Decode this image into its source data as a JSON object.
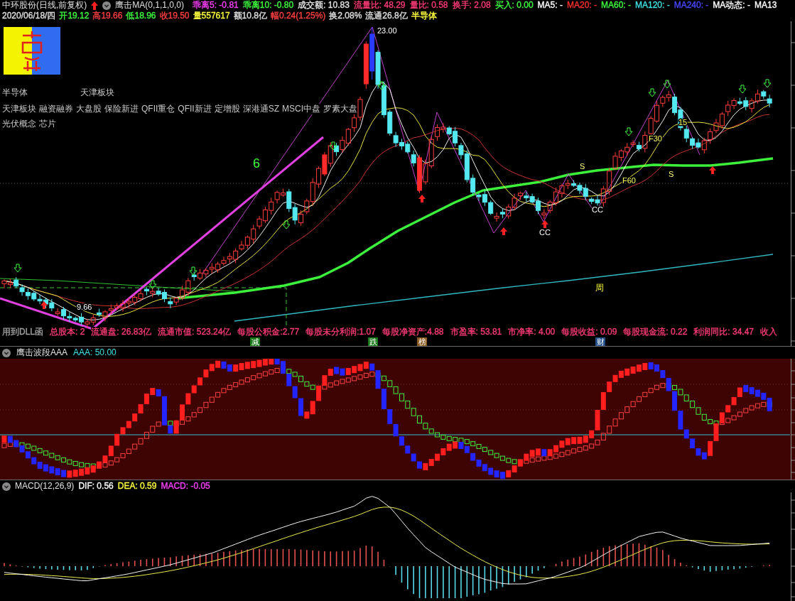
{
  "header": {
    "title": "中环股份(日线,前复权)",
    "formula": "鹰击MA(0,1,1,0,0)",
    "readouts": [
      {
        "text": "乖离5: -0.81",
        "color": "#ff40ff"
      },
      {
        "text": "乖离10: -0.80",
        "color": "#40ff40"
      },
      {
        "text": "成交额: 10.83",
        "color": "#e0e0e0"
      },
      {
        "text": "流量比: 48.29",
        "color": "#ff3c78"
      },
      {
        "text": "量比: 0.58",
        "color": "#ff3c78"
      },
      {
        "text": "换手: 2.08",
        "color": "#ff3c78"
      },
      {
        "text": "买入: 0.00",
        "color": "#40ff40"
      },
      {
        "text": "MA5: -",
        "color": "#ffffff"
      },
      {
        "text": "MA20: -",
        "color": "#ff3030"
      },
      {
        "text": "MA60: -",
        "color": "#40ff40"
      },
      {
        "text": "MA120: -",
        "color": "#40e0e0"
      },
      {
        "text": "MA240: -",
        "color": "#4848ff"
      },
      {
        "text": "MA动态: -",
        "color": "#ffffff"
      },
      {
        "text": "MA13",
        "color": "#ffffff"
      }
    ]
  },
  "quote": [
    {
      "text": "2020/06/18/四",
      "color": "#e0e0e0"
    },
    {
      "text": "开19.12",
      "color": "#40ff40"
    },
    {
      "text": "高19.66",
      "color": "#ff4040"
    },
    {
      "text": "低18.96",
      "color": "#40ff40"
    },
    {
      "text": "收19.50",
      "color": "#ff4040"
    },
    {
      "text": "量557617",
      "color": "#ffff40"
    },
    {
      "text": "额10.8亿",
      "color": "#e0e0e0"
    },
    {
      "text": "幅0.24(1.25%)",
      "color": "#ff4040"
    },
    {
      "text": "换2.08%",
      "color": "#e0e0e0"
    },
    {
      "text": "流通26.8亿",
      "color": "#e0e0e0"
    },
    {
      "text": "半导体",
      "color": "#ffff40"
    }
  ],
  "main_chart": {
    "sectors": [
      "半导体",
      "天津板块"
    ],
    "tags": [
      "天津板块",
      "融资融券",
      "大盘股",
      "保险新进",
      "QFII重仓",
      "QFII新进",
      "定增股",
      "深港通SZ",
      "MSCI中盘",
      "罗素大盘"
    ],
    "concepts": [
      "光伏概念",
      "芯片"
    ],
    "labels": [
      "6",
      "23.00",
      "9.66",
      "CC",
      "S",
      "CC",
      "F60",
      "F30",
      "15",
      "S",
      "周"
    ],
    "fundamentals": [
      {
        "text": "用到DLL函",
        "color": "#a0a0a0"
      },
      {
        "text": "总股本: 2",
        "color": "#ff3c78"
      },
      {
        "text": "流通盘: 26.83亿",
        "color": "#ff3c78"
      },
      {
        "text": "流通市值: 523.24亿",
        "color": "#ff3c78"
      },
      {
        "text": "每股公积金:2.77",
        "color": "#ff3c78"
      },
      {
        "text": "每股未分利润:1.07",
        "color": "#ff3c78"
      },
      {
        "text": "每股净资产:4.88",
        "color": "#ff3c78"
      },
      {
        "text": "市盈率: 53.81",
        "color": "#ff3c78"
      },
      {
        "text": "市净率: 4.00",
        "color": "#ff3c78"
      },
      {
        "text": "每股收益: 0.09",
        "color": "#ff3c78"
      },
      {
        "text": "每股现金流: 0.22",
        "color": "#ff3c78"
      },
      {
        "text": "利润同比: 34.47",
        "color": "#ff3c78"
      },
      {
        "text": "收入",
        "color": "#ff3c78"
      }
    ],
    "events": [
      {
        "text": "减",
        "color": "#1a7a1a"
      },
      {
        "text": "跌",
        "color": "#1a7a1a"
      },
      {
        "text": "榜",
        "color": "#8a5a20"
      },
      {
        "text": "财",
        "color": "#24508a"
      }
    ]
  },
  "wave_panel": {
    "title": "鹰击波段AAA",
    "readout": "AAA: 50.00"
  },
  "macd_panel": {
    "title": "MACD(12,26,9)",
    "readouts": [
      {
        "text": "DIF: 0.56",
        "color": "#ffffff"
      },
      {
        "text": "DEA: 0.59",
        "color": "#ffff40"
      },
      {
        "text": "MACD: -0.05",
        "color": "#ff40ff"
      }
    ]
  }
}
